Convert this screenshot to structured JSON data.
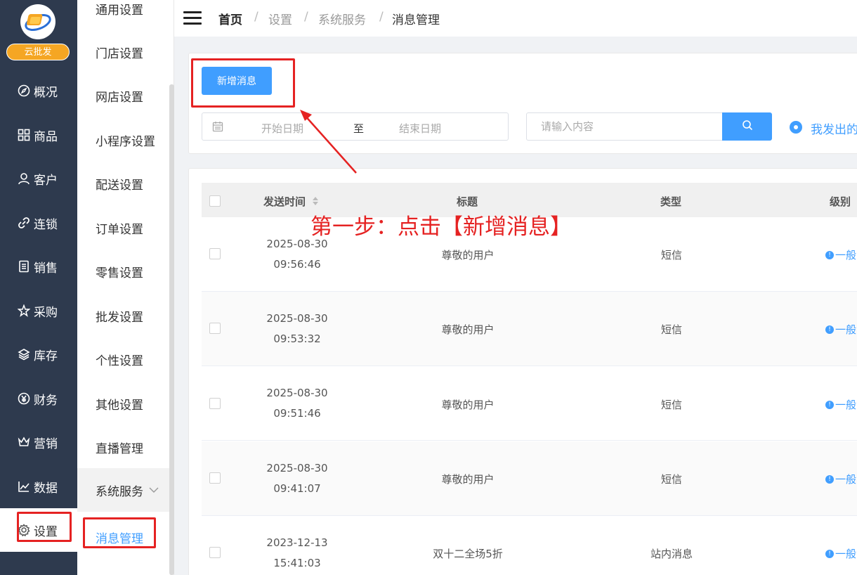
{
  "brand": {
    "badge": "云批发"
  },
  "primary_nav": [
    {
      "label": "概况",
      "icon": "compass-icon"
    },
    {
      "label": "商品",
      "icon": "grid-icon"
    },
    {
      "label": "客户",
      "icon": "user-icon"
    },
    {
      "label": "连锁",
      "icon": "link-icon"
    },
    {
      "label": "销售",
      "icon": "document-icon"
    },
    {
      "label": "采购",
      "icon": "star-icon"
    },
    {
      "label": "库存",
      "icon": "layers-icon"
    },
    {
      "label": "财务",
      "icon": "yen-icon"
    },
    {
      "label": "营销",
      "icon": "crown-icon"
    },
    {
      "label": "数据",
      "icon": "chart-icon"
    },
    {
      "label": "设置",
      "icon": "gear-icon",
      "active": true
    }
  ],
  "secondary_nav": {
    "items": [
      "通用设置",
      "门店设置",
      "网店设置",
      "小程序设置",
      "配送设置",
      "订单设置",
      "零售设置",
      "批发设置",
      "个性设置",
      "其他设置",
      "直播管理"
    ],
    "group": "系统服务",
    "active_item": "消息管理"
  },
  "breadcrumb": [
    "首页",
    "设置",
    "系统服务",
    "消息管理"
  ],
  "toolbar": {
    "add_button": "新增消息",
    "date_start_placeholder": "开始日期",
    "date_separator": "至",
    "date_end_placeholder": "结束日期",
    "search_placeholder": "请输入内容",
    "radio_label": "我发出的"
  },
  "table": {
    "columns": [
      "发送时间",
      "标题",
      "类型",
      "级别"
    ],
    "rows": [
      {
        "date": "2025-08-30",
        "time": "09:56:46",
        "title": "尊敬的用户",
        "type": "短信",
        "level": "一般"
      },
      {
        "date": "2025-08-30",
        "time": "09:53:32",
        "title": "尊敬的用户",
        "type": "短信",
        "level": "一般"
      },
      {
        "date": "2025-08-30",
        "time": "09:51:46",
        "title": "尊敬的用户",
        "type": "短信",
        "level": "一般"
      },
      {
        "date": "2025-08-30",
        "time": "09:41:07",
        "title": "尊敬的用户",
        "type": "短信",
        "level": "一般"
      },
      {
        "date": "2023-12-13",
        "time": "15:41:03",
        "title": "双十二全场5折",
        "type": "站内消息",
        "level": "一般"
      }
    ]
  },
  "annotation": {
    "text": "第一步：点击【新增消息】"
  },
  "colors": {
    "accent": "#409eff",
    "sidebar": "#2e3a4e",
    "annotation": "#e52222"
  }
}
